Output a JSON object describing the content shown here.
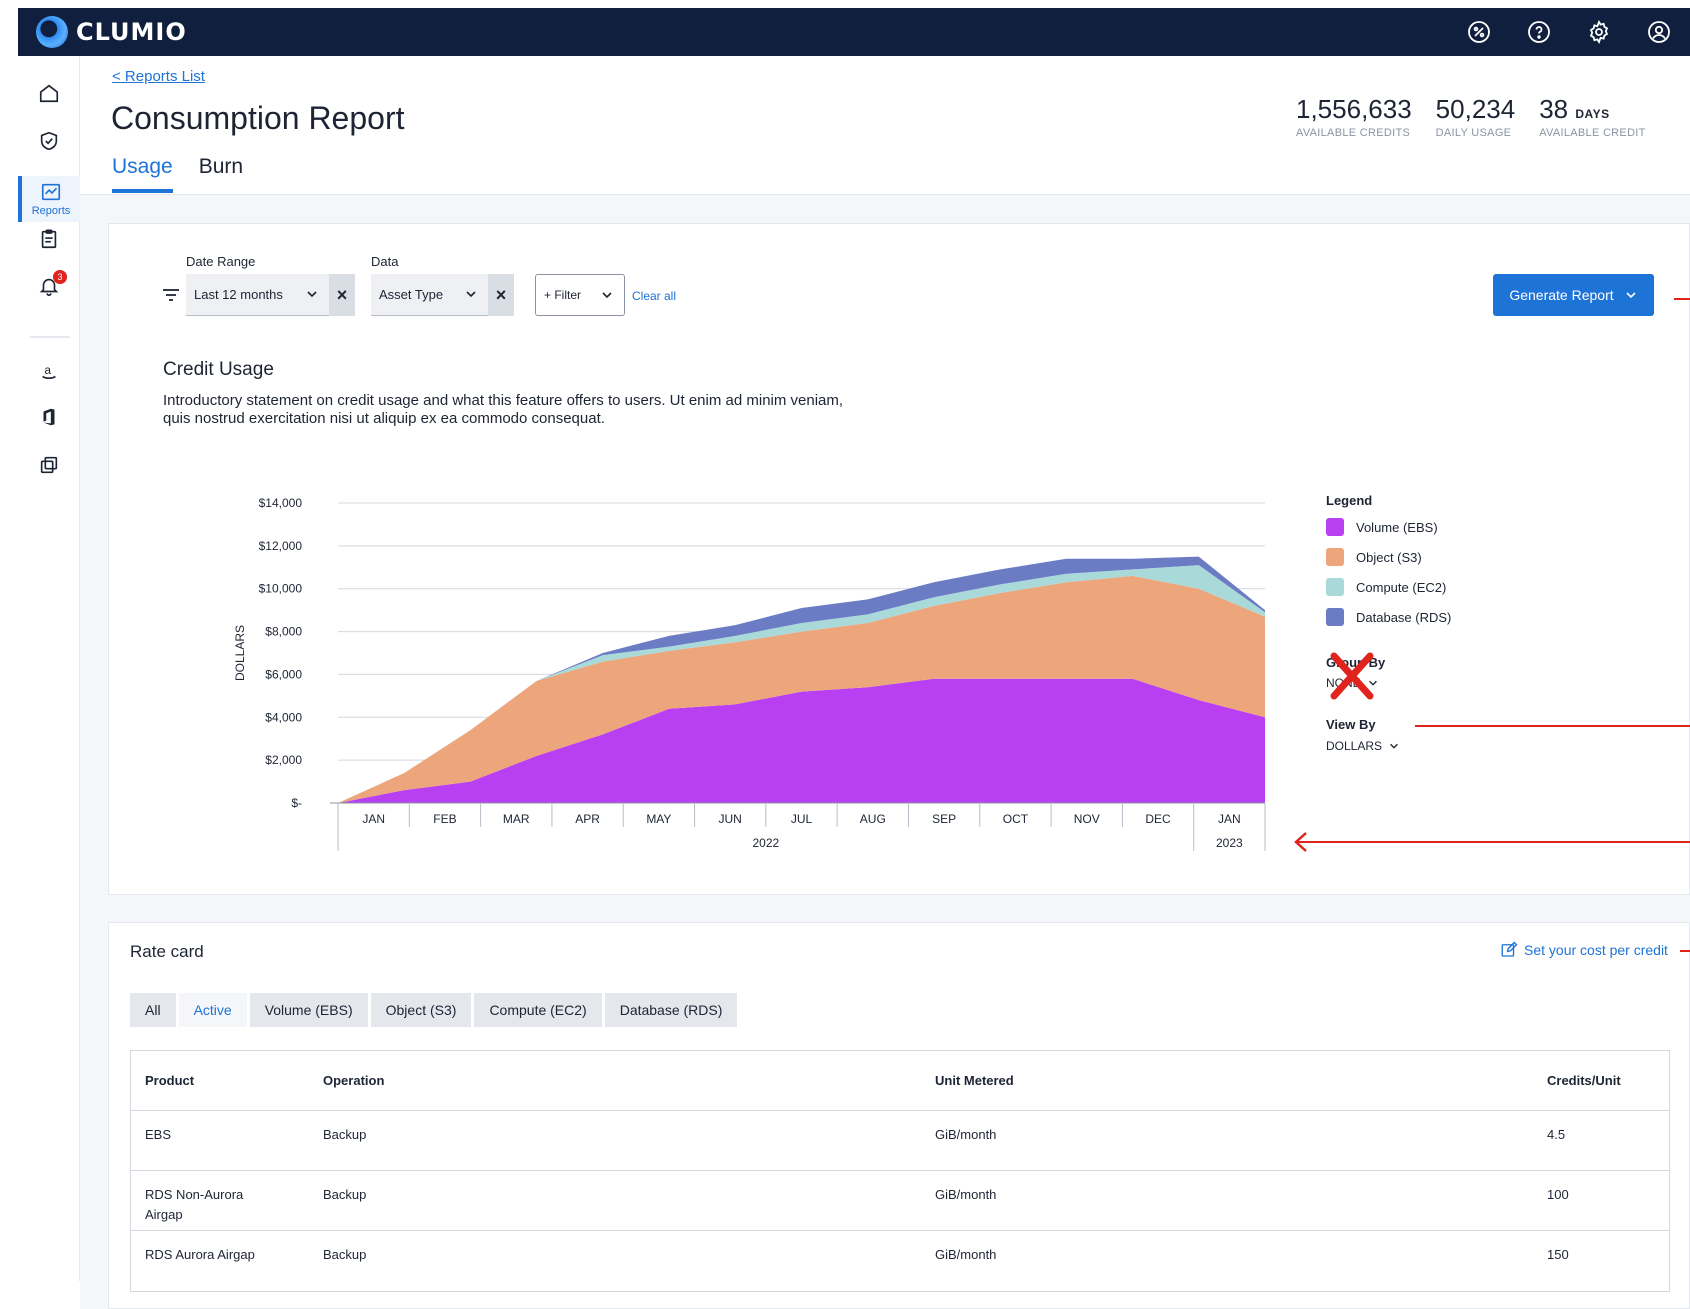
{
  "app": {
    "name": "CLUMIO"
  },
  "top_icons": [
    "percent-icon",
    "help-icon",
    "settings-icon",
    "user-icon"
  ],
  "sidebar": {
    "items": [
      {
        "name": "home",
        "label": ""
      },
      {
        "name": "protection",
        "label": ""
      },
      {
        "name": "reports",
        "label": "Reports",
        "active": true
      },
      {
        "name": "tasks",
        "label": ""
      },
      {
        "name": "alerts",
        "label": "",
        "badge": "3"
      },
      {
        "name": "aws",
        "label": ""
      },
      {
        "name": "microsoft",
        "label": ""
      },
      {
        "name": "copy",
        "label": ""
      }
    ]
  },
  "header": {
    "breadcrumb": "< Reports List",
    "title": "Consumption Report",
    "tabs": [
      {
        "label": "Usage",
        "active": true
      },
      {
        "label": "Burn",
        "active": false
      }
    ],
    "stats": [
      {
        "value": "1,556,633",
        "unit": "",
        "label": "AVAILABLE CREDITS"
      },
      {
        "value": "50,234",
        "unit": "",
        "label": "DAILY USAGE"
      },
      {
        "value": "38",
        "unit": "DAYS",
        "label": "AVAILABLE CREDIT"
      }
    ]
  },
  "filters": {
    "date_range_label": "Date Range",
    "date_range_value": "Last 12 months",
    "data_label": "Data",
    "data_value": "Asset Type",
    "filter_button": "+ Filter",
    "clear_all": "Clear all",
    "generate_button": "Generate Report"
  },
  "credit_usage": {
    "title": "Credit Usage",
    "intro_line1": "Introductory statement on credit usage and what this feature offers to users. Ut enim ad minim veniam,",
    "intro_line2": "quis nostrud exercitation nisi ut aliquip ex ea commodo consequat.",
    "legend_title": "Legend",
    "group_by_label": "Group By",
    "group_by_value": "NONE",
    "view_by_label": "View By",
    "view_by_value": "DOLLARS"
  },
  "chart_data": {
    "type": "area",
    "stacked": true,
    "ylabel": "DOLLARS",
    "ylim": [
      0,
      14000
    ],
    "y_ticks": [
      "$14,000",
      "$12,000",
      "$10,000",
      "$8,000",
      "$6,000",
      "$4,000",
      "$2,000",
      "$-"
    ],
    "x_ticks": [
      "JAN",
      "FEB",
      "MAR",
      "APR",
      "MAY",
      "JUN",
      "JUL",
      "AUG",
      "SEP",
      "OCT",
      "NOV",
      "DEC",
      "JAN"
    ],
    "x_year_labels": [
      "2022",
      "2023"
    ],
    "x": [
      "JAN 2022 start",
      "JAN",
      "FEB",
      "MAR",
      "APR",
      "MAY",
      "JUN",
      "JUL",
      "AUG",
      "SEP",
      "OCT",
      "NOV",
      "DEC",
      "DEC end",
      "JAN 2023"
    ],
    "series": [
      {
        "name": "Volume (EBS)",
        "color": "#b940f2",
        "values": [
          0,
          600,
          1000,
          2200,
          3200,
          4400,
          4600,
          5200,
          5400,
          5800,
          5800,
          5800,
          5800,
          4800,
          4000
        ]
      },
      {
        "name": "Object (S3)",
        "color": "#eda67c",
        "values": [
          0,
          800,
          2400,
          3500,
          3400,
          2700,
          2900,
          2800,
          3000,
          3400,
          4000,
          4500,
          4800,
          5200,
          4700
        ]
      },
      {
        "name": "Compute (EC2)",
        "color": "#a9dad9",
        "values": [
          0,
          0,
          0,
          0,
          300,
          200,
          300,
          400,
          400,
          400,
          400,
          400,
          300,
          1100,
          200
        ]
      },
      {
        "name": "Database (RDS)",
        "color": "#6b7cc4",
        "values": [
          0,
          0,
          0,
          0,
          100,
          500,
          500,
          700,
          700,
          700,
          700,
          700,
          500,
          400,
          100
        ]
      }
    ]
  },
  "rate_card": {
    "title": "Rate card",
    "set_cost": "Set your cost per credit",
    "chips": [
      {
        "label": "All",
        "active": false
      },
      {
        "label": "Active",
        "active": true
      },
      {
        "label": "Volume (EBS)",
        "active": false
      },
      {
        "label": "Object (S3)",
        "active": false
      },
      {
        "label": "Compute (EC2)",
        "active": false
      },
      {
        "label": "Database (RDS)",
        "active": false
      }
    ],
    "columns": [
      "Product",
      "Operation",
      "Unit Metered",
      "Credits/Unit"
    ],
    "rows": [
      {
        "product_line1": "EBS",
        "product_line2": "",
        "operation": "Backup",
        "unit": "GiB/month",
        "credits": "4.5"
      },
      {
        "product_line1": "RDS Non-Aurora",
        "product_line2": "Airgap",
        "operation": "Backup",
        "unit": "GiB/month",
        "credits": "100"
      },
      {
        "product_line1": "RDS Aurora Airgap",
        "product_line2": "",
        "operation": "Backup",
        "unit": "GiB/month",
        "credits": "150"
      }
    ]
  },
  "annotation_color": "#e0231c"
}
